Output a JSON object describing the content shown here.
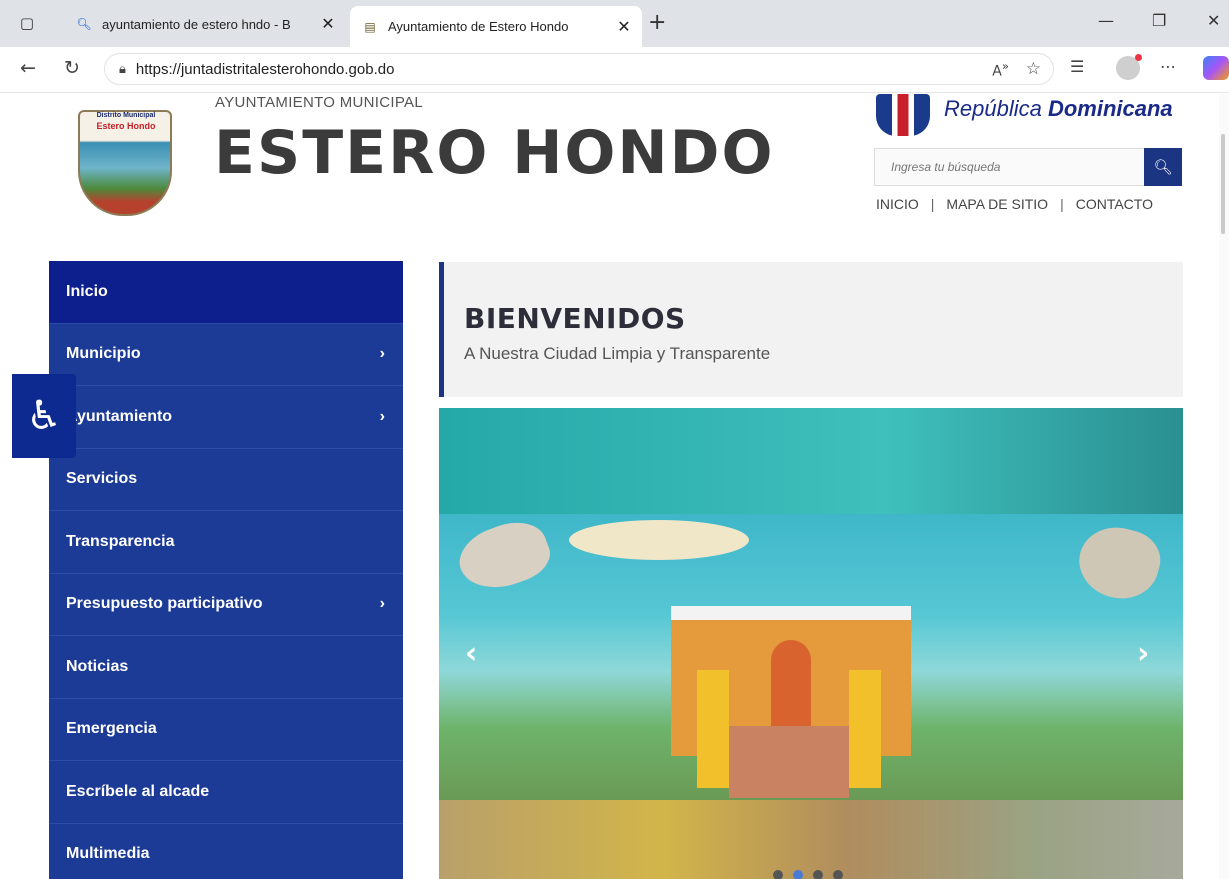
{
  "browser": {
    "tabs": [
      {
        "title": "ayuntamiento de estero hndo - B",
        "active": false
      },
      {
        "title": "Ayuntamiento de Estero Hondo",
        "active": true
      }
    ],
    "url": "https://juntadistritalesterohondo.gob.do"
  },
  "header": {
    "crest_line1": "Distrito Municipal",
    "crest_line2": "Estero Hondo",
    "overline": "AYUNTAMIENTO MUNICIPAL",
    "brand": "ESTERO HONDO",
    "republic_light": "República ",
    "republic_bold": "Dominicana",
    "search_placeholder": "Ingresa tu búsqueda",
    "links": [
      "INICIO",
      "MAPA DE SITIO",
      "CONTACTO"
    ],
    "separator": "|"
  },
  "sidebar": {
    "items": [
      {
        "label": "Inicio",
        "has_children": false,
        "active": true
      },
      {
        "label": "Municipio",
        "has_children": true
      },
      {
        "label": "Ayuntamiento",
        "has_children": true
      },
      {
        "label": "Servicios",
        "has_children": false
      },
      {
        "label": "Transparencia",
        "has_children": false
      },
      {
        "label": "Presupuesto participativo",
        "has_children": true
      },
      {
        "label": "Noticias",
        "has_children": false
      },
      {
        "label": "Emergencia",
        "has_children": false
      },
      {
        "label": "Escríbele al alcade",
        "has_children": false
      },
      {
        "label": "Multimedia",
        "has_children": false
      }
    ]
  },
  "welcome": {
    "title": "BIENVENIDOS",
    "subtitle": "A Nuestra Ciudad Limpia y Transparente"
  },
  "carousel": {
    "slide_count": 4,
    "active_slide": 2
  },
  "icons": {
    "accessibility": "wheelchair-icon",
    "search": "search-icon"
  },
  "colors": {
    "nav_blue": "#1c3b96",
    "nav_active": "#0c1f8c",
    "accent": "#1c3583"
  }
}
